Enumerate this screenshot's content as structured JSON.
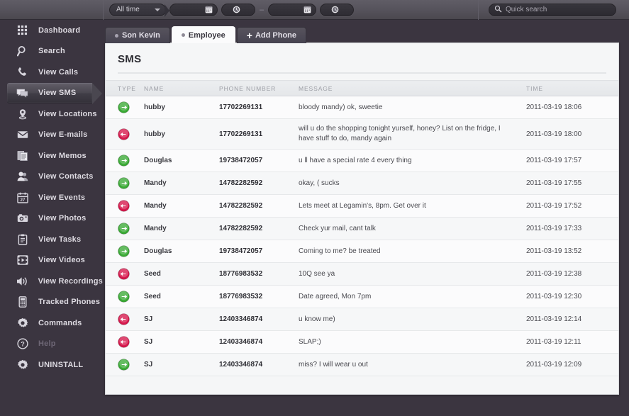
{
  "toolbar": {
    "range_select": {
      "value": "All time",
      "icon": "chevron-down-icon"
    },
    "date_from": {
      "value": "",
      "icon": "calendar-icon"
    },
    "time_from": {
      "value": "",
      "icon": "clock-icon"
    },
    "separator": "–",
    "date_to": {
      "value": "",
      "icon": "calendar-icon"
    },
    "time_to": {
      "value": "",
      "icon": "clock-icon"
    }
  },
  "search": {
    "placeholder": "Quick search",
    "icon": "search-icon"
  },
  "sidebar": {
    "items": [
      {
        "label": "Dashboard",
        "icon": "grid-icon",
        "active": false,
        "disabled": false
      },
      {
        "label": "Search",
        "icon": "magnifier-icon",
        "active": false,
        "disabled": false
      },
      {
        "label": "View Calls",
        "icon": "phone-icon",
        "active": false,
        "disabled": false
      },
      {
        "label": "View SMS",
        "icon": "chat-bubble-icon",
        "active": true,
        "disabled": false
      },
      {
        "label": "View Locations",
        "icon": "map-pin-icon",
        "active": false,
        "disabled": false
      },
      {
        "label": "View E-mails",
        "icon": "envelope-icon",
        "active": false,
        "disabled": false
      },
      {
        "label": "View Memos",
        "icon": "documents-icon",
        "active": false,
        "disabled": false
      },
      {
        "label": "View Contacts",
        "icon": "people-icon",
        "active": false,
        "disabled": false
      },
      {
        "label": "View Events",
        "icon": "calendar-27-icon",
        "active": false,
        "disabled": false
      },
      {
        "label": "View Photos",
        "icon": "camera-icon",
        "active": false,
        "disabled": false
      },
      {
        "label": "View Tasks",
        "icon": "clipboard-icon",
        "active": false,
        "disabled": false
      },
      {
        "label": "View Videos",
        "icon": "film-icon",
        "active": false,
        "disabled": false
      },
      {
        "label": "View Recordings",
        "icon": "speaker-icon",
        "active": false,
        "disabled": false
      },
      {
        "label": "Tracked Phones",
        "icon": "mobile-icon",
        "active": false,
        "disabled": false
      },
      {
        "label": "Commands",
        "icon": "gear-icon",
        "active": false,
        "disabled": false
      },
      {
        "label": "Help",
        "icon": "question-icon",
        "active": false,
        "disabled": true
      },
      {
        "label": "UNINSTALL",
        "icon": "gear-icon",
        "active": false,
        "disabled": false
      }
    ]
  },
  "tabs": [
    {
      "label": "Son Kevin",
      "active": false,
      "add": false
    },
    {
      "label": "Employee",
      "active": true,
      "add": false
    },
    {
      "label": "Add Phone",
      "active": false,
      "add": true
    }
  ],
  "panel": {
    "title": "SMS",
    "columns": [
      "TYPE",
      "NAME",
      "PHONE NUMBER",
      "MESSAGE",
      "TIME"
    ],
    "rows": [
      {
        "type": "outgoing",
        "name": "hubby",
        "phone": "17702269131",
        "message": "bloody mandy) ok, sweetie",
        "time": "2011-03-19 18:06"
      },
      {
        "type": "incoming",
        "name": "hubby",
        "phone": "17702269131",
        "message": "will u do the shopping tonight yurself, honey? List on the fridge, I have stuff to do, mandy again",
        "time": "2011-03-19 18:00"
      },
      {
        "type": "outgoing",
        "name": "Douglas",
        "phone": "19738472057",
        "message": "u ll have a special rate 4 every thing",
        "time": "2011-03-19 17:57"
      },
      {
        "type": "outgoing",
        "name": "Mandy",
        "phone": "14782282592",
        "message": "okay, ( sucks",
        "time": "2011-03-19 17:55"
      },
      {
        "type": "incoming",
        "name": "Mandy",
        "phone": "14782282592",
        "message": "Lets meet at Legamin's, 8pm. Get over it",
        "time": "2011-03-19 17:52"
      },
      {
        "type": "outgoing",
        "name": "Mandy",
        "phone": "14782282592",
        "message": "Check yur mail, cant talk",
        "time": "2011-03-19 17:33"
      },
      {
        "type": "outgoing",
        "name": "Douglas",
        "phone": "19738472057",
        "message": "Coming to me? be treated",
        "time": "2011-03-19 13:52"
      },
      {
        "type": "incoming",
        "name": "Seed",
        "phone": "18776983532",
        "message": "10Q see ya",
        "time": "2011-03-19 12:38"
      },
      {
        "type": "outgoing",
        "name": "Seed",
        "phone": "18776983532",
        "message": "Date agreed, Mon 7pm",
        "time": "2011-03-19 12:30"
      },
      {
        "type": "incoming",
        "name": "SJ",
        "phone": "12403346874",
        "message": "u know me)",
        "time": "2011-03-19 12:14"
      },
      {
        "type": "incoming",
        "name": "SJ",
        "phone": "12403346874",
        "message": "SLAP;)",
        "time": "2011-03-19 12:11"
      },
      {
        "type": "outgoing",
        "name": "SJ",
        "phone": "12403346874",
        "message": "miss? I will wear u out",
        "time": "2011-03-19 12:09"
      }
    ]
  },
  "colors": {
    "outgoing": "#3aaa35",
    "incoming": "#d6174b",
    "sidebar_bg": "#3b3540",
    "topbar_bg": "#56535c",
    "panel_bg": "#f5f6f7"
  }
}
